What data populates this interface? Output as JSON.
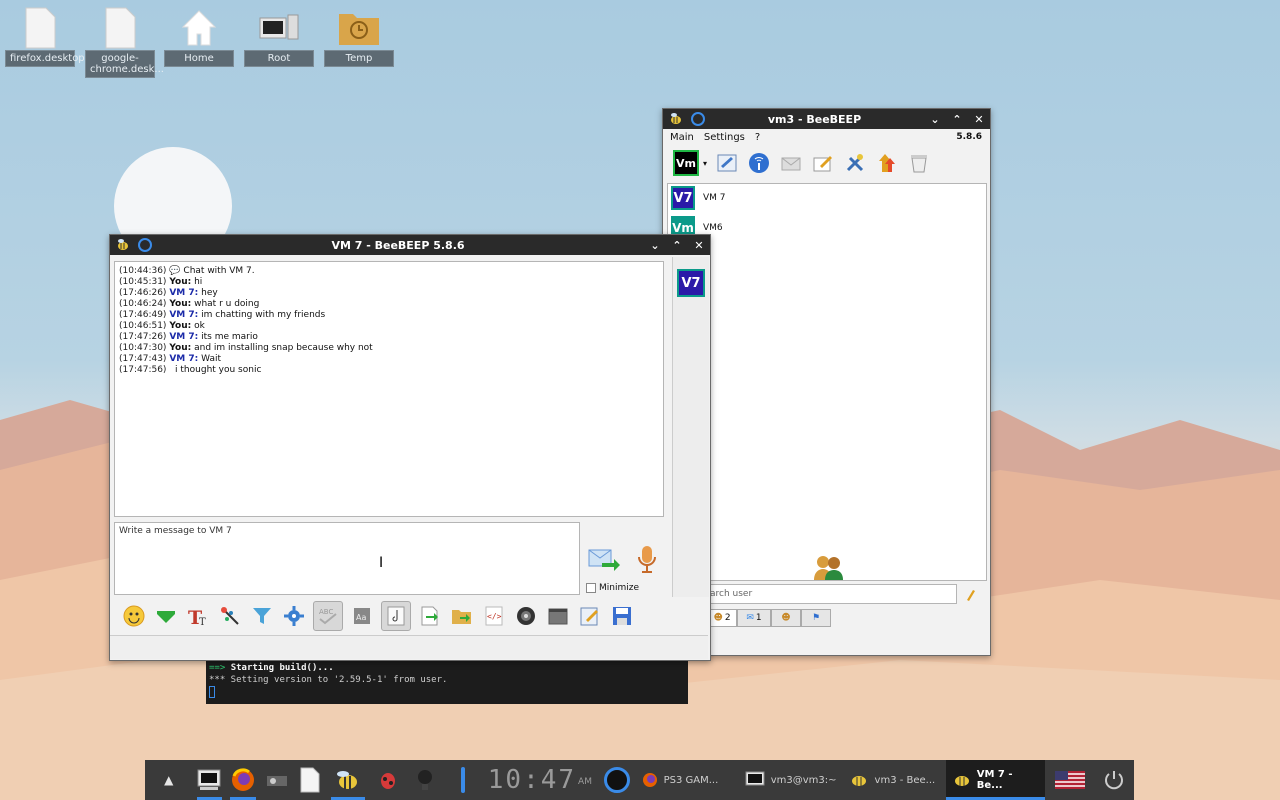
{
  "desktop": {
    "icons": [
      {
        "label": "firefox.desktop"
      },
      {
        "label": "google-chrome.desk..."
      },
      {
        "label": "Home"
      },
      {
        "label": "Root"
      },
      {
        "label": "Temp"
      }
    ]
  },
  "chat_window": {
    "title": "VM 7 - BeeBEEP 5.8.6",
    "messages": [
      {
        "time": "(10:44:36)",
        "sender": "",
        "text": "Chat with VM 7."
      },
      {
        "time": "(10:45:31)",
        "sender": "You:",
        "text": "hi"
      },
      {
        "time": "(17:46:26)",
        "sender": "VM 7:",
        "text": "hey"
      },
      {
        "time": "(10:46:24)",
        "sender": "You:",
        "text": "what r u doing"
      },
      {
        "time": "(17:46:49)",
        "sender": "VM 7:",
        "text": "im chatting with my friends"
      },
      {
        "time": "(10:46:51)",
        "sender": "You:",
        "text": "ok"
      },
      {
        "time": "(17:47:26)",
        "sender": "VM 7:",
        "text": "its me mario"
      },
      {
        "time": "(10:47:30)",
        "sender": "You:",
        "text": "and im installing snap because why not"
      },
      {
        "time": "(17:47:43)",
        "sender": "VM 7:",
        "text": "Wait"
      },
      {
        "time": "(17:47:56)",
        "sender": "",
        "text": "i thought you sonic"
      }
    ],
    "input_placeholder": "Write a message to VM 7",
    "minimize_label": "Minimize",
    "side_avatar": "V7"
  },
  "main_window": {
    "title": "vm3 - BeeBEEP",
    "menu": [
      "Main",
      "Settings",
      "?"
    ],
    "version": "5.8.6",
    "user_avatar": "Vm",
    "users": [
      {
        "avatar": "V7",
        "name": "VM 7"
      },
      {
        "avatar": "Vm",
        "name": "VM6"
      }
    ],
    "search_placeholder": "arch user",
    "tabs": [
      {
        "count": "2"
      },
      {
        "count": "1"
      },
      {
        "count": ""
      },
      {
        "count": ""
      }
    ]
  },
  "terminal": {
    "line1_prefix": "==>",
    "line1": "Starting build()...",
    "line2": "*** Setting version to '2.59.5-1' from user."
  },
  "taskbar": {
    "clock": "10:47",
    "clock_suffix": "AM",
    "tasks": [
      {
        "label": "PS3 GAM..."
      },
      {
        "label": "vm3@vm3:~"
      },
      {
        "label": "vm3 - Bee..."
      },
      {
        "label": "VM 7 - Be..."
      }
    ]
  },
  "colors": {
    "accent": "#3a8be8",
    "avatar_v7": "#2a1aa8",
    "avatar_vm": "#0b9a8a",
    "titlebar": "#2a2a2a"
  }
}
